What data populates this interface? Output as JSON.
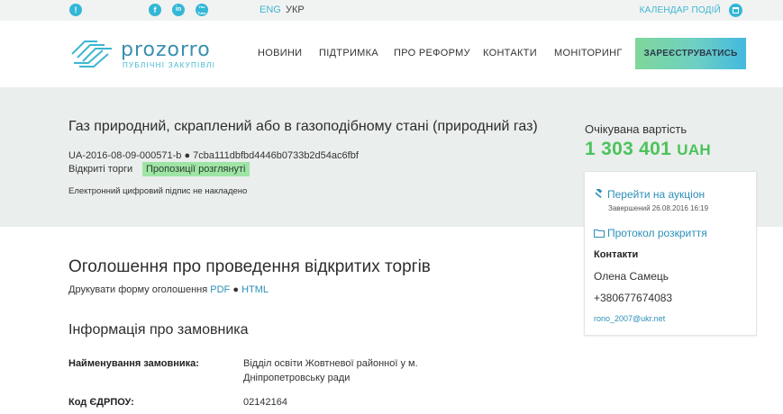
{
  "topbar": {
    "info_icon": "!",
    "social": [
      "f",
      "in",
      "You Tube"
    ],
    "lang_eng": "ENG",
    "lang_ukr": "УКР",
    "calendar_link": "КАЛЕНДАР ПОДІЙ"
  },
  "header": {
    "logo_text": "prozorro",
    "logo_sub": "ПУБЛІЧНІ ЗАКУПІВЛІ",
    "nav": [
      "НОВИНИ",
      "ПІДТРИМКА",
      "ПРО РЕФОРМУ",
      "КОНТАКТИ",
      "МОНІТОРИНГ"
    ],
    "register_button": "ЗАРЕЄСТРУВАТИСЬ"
  },
  "tender": {
    "title": "Газ природний, скраплений або в газоподібному стані (природний газ)",
    "id": "UA-2016-08-09-000571-b",
    "hash": "7cba111dbfbd4446b0733b2d54ac6fbf",
    "type": "Відкриті торги",
    "status": "Пропозиції розглянуті",
    "signature": "Електронний цифровий підпис не накладено",
    "expected_label": "Очікувана вартість",
    "expected_amount": "1 303 401",
    "expected_currency": "UAH"
  },
  "card": {
    "auction_link": "Перейти на аукціон",
    "auction_sub": "Завершений 26.08.2016 16:19",
    "protocol_link": "Протокол розкриття",
    "contacts_title": "Контакти",
    "contact_name": "Олена Самець",
    "contact_phone": "+380677674083",
    "contact_email": "rono_2007@ukr.net"
  },
  "body": {
    "announcement_title": "Оголошення про проведення відкритих торгів",
    "print_label": "Друкувати форму оголошення",
    "print_pdf": "PDF",
    "print_html": "HTML",
    "customer_title": "Інформація про замовника",
    "rows": [
      {
        "label": "Найменування замовника:",
        "value": "Відділ освіти Жовтневої районної у м. Дніпропетровську ради"
      },
      {
        "label": "Код ЄДРПОУ:",
        "value": "02142164"
      }
    ]
  },
  "colors": {
    "accent": "#33b7d6",
    "price": "#4cc35c",
    "badge": "#9ee5a5",
    "hero_bg": "#eaeeec"
  }
}
